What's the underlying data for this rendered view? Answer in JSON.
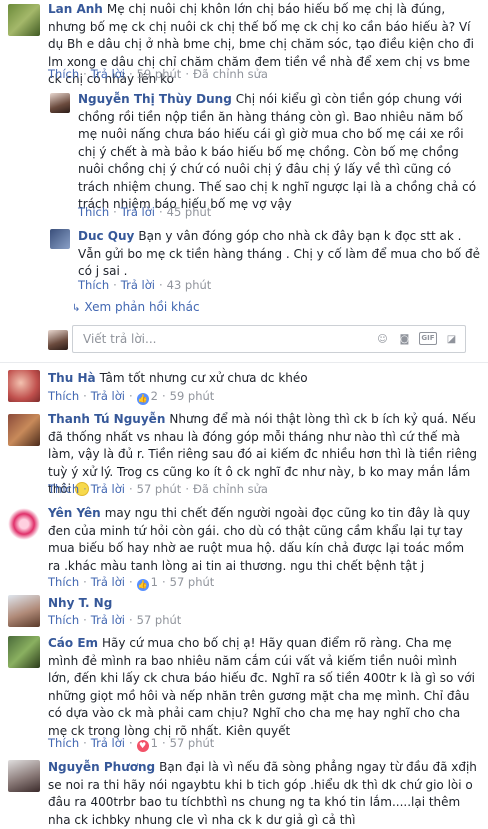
{
  "actions": {
    "like": "Thích",
    "reply": "Trả lời",
    "edited": "Đã chỉnh sửa",
    "more_replies": "Xem phản hồi khác",
    "reply_placeholder": "Viết trả lời..."
  },
  "comments": [
    {
      "name": "Lan Anh",
      "text": "Mẹ chị nuôi chị khôn lớn chị báo hiếu bố mẹ chị là đúng, nhưng bố mẹ ck chị nuôi ck chị thế bố mẹ ck chị ko cần báo hiếu à? Ví dụ Bh e dâu chị ở nhà bme chị, bme chị chăm sóc, tạo điều kiện cho đi lm xong e dâu chị chỉ chăm chăm đem tiền về nhà để xem chị vs bme ck chị có nhảy lên ko",
      "time": "59 phút"
    },
    {
      "name": "Nguyễn Thị Thùy Dung",
      "text": "Chị nói kiểu gì còn tiền góp chung với chồng rồi tiền nộp tiền ăn hàng tháng còn gì. Bao nhiêu năm bố mẹ nuôi nấng chưa báo hiếu cái gì giờ mua cho bố mẹ cái xe rồi chị ý chết à mà bảo k báo hiếu bố mẹ chồng. Còn bố mẹ chồng nuôi chồng chị ý chứ có nuôi chị ý đâu chị ý lấy về thì cũng có trách nhiệm chung. Thế sao chị k nghĩ ngược lại là a chồng chả có trách nhiệm báo hiếu bố mẹ vợ vậy",
      "time": "45 phút"
    },
    {
      "name": "Duc Quy",
      "text": "Bạn y vân đóng góp cho nhà ck đây bạn k đọc stt ak . Vẫn gửi bo mẹ ck tiền hàng tháng . Chị y cố làm để mua cho bố đẻ có j sai .",
      "time": "43 phút"
    },
    {
      "name": "Thu Hà",
      "text": "Tâm tốt nhưng cư xử chưa dc khéo",
      "likes": "2",
      "time": "59 phút"
    },
    {
      "name": "Thanh Tú Nguyễn",
      "text": "Nhưng để mà nói thật lòng thì ck b ích kỷ quá. Nếu đã thống nhất vs nhau là đóng góp mỗi tháng như nào thì cứ thế mà làm, vậy là đủ r. Tiền riêng sau đó ai kiếm đc nhiều hơn thì là tiền riêng tuỳ ý xử lý. Trog cs cũng ko ít ô ck nghĩ đc như này, b ko may mắn lắm thôi",
      "time": "57 phút"
    },
    {
      "name": "Yên Yên",
      "text": "may ngu thi chết đến người ngoài đọc cũng ko tin đây là quy đen của minh tứ hỏi còn gái. cho dù có thật cũng cầm khẩu lại tự tay mua biếu bố hay nhờ ae ruột mua hộ. dấu kín chả được lại toác mồm ra .khác màu tanh lòng ai tin ai thương. ngu thi chết bệnh tật j",
      "likes": "1",
      "time": "57 phút"
    },
    {
      "name": "Nhy T. Ng",
      "text": "",
      "time": "57 phút"
    },
    {
      "name": "Cáo Em",
      "text": "Hãy cứ mua cho bố chị ạ! Hãy quan điểm rõ ràng. Cha mẹ mình đẻ mình ra bao nhiêu năm cắm cúi vất vả kiếm tiền nuôi mình lớn, đến khi lấy ck chưa báo hiếu đc. Nghĩ ra số tiền 400tr k là gì so với những giọt mồ hôi và nếp nhăn trên gương mặt cha mẹ mình. Chỉ đâu có dựa vào ck mà phải cam chịu? Nghĩ cho cha mẹ hay nghĩ cho cha mẹ ck trong lòng chị rõ nhất. Kiên quyết",
      "likes": "1",
      "time": "57 phút"
    },
    {
      "name": "Nguyễn Phương",
      "text": "Bạn đại là vì nếu đã sòng phẳng ngay từ đầu đã xđịh se noi ra thi hãy nói ngaybtu khi b tich góp .hiểu dk thì dk chứ gio lòi o đâu ra 400trbr bao tu tíchbthì ns chung ng ta khó tin lắm.....lại thêm nha ck ichbky nhung cle vì nha ck k dư giả gì cả thì",
      "time": ""
    }
  ],
  "colors": {
    "name": "#365899",
    "link": "#4267b2",
    "meta": "#90949c",
    "like_icon": "#5890ff",
    "heart_icon": "#f25268"
  }
}
